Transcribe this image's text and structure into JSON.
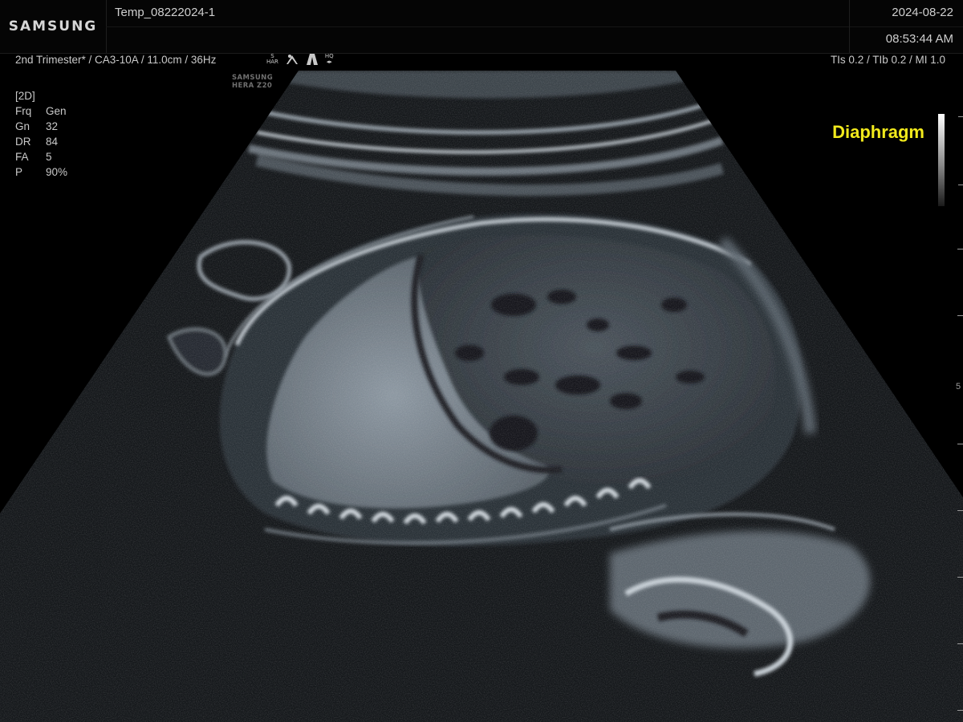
{
  "header": {
    "brand": "SAMSUNG",
    "patient_id": "Temp_08222024-1",
    "date": "2024-08-22",
    "time": "08:53:44 AM"
  },
  "info_line": {
    "text": "2nd Trimester* / CA3-10A / 11.0cm / 36Hz",
    "icon_s_har_top": "S",
    "icon_s_har_bottom": "HAR",
    "icon_hq_top": "HQ",
    "icon_hq_bottom": "◂▸"
  },
  "safety": {
    "text": "TIs  0.2 / TIb  0.2 / MI    1.0"
  },
  "watermark": {
    "line1": "SAMSUNG",
    "line2": "HERA Z20"
  },
  "params": {
    "mode": "[2D]",
    "rows": [
      {
        "key": "Frq",
        "value": "Gen"
      },
      {
        "key": "Gn",
        "value": "32"
      },
      {
        "key": "DR",
        "value": "84"
      },
      {
        "key": "FA",
        "value": "5"
      },
      {
        "key": "P",
        "value": "90%"
      }
    ]
  },
  "annotation": {
    "label": "Diaphragm",
    "color": "#f2ea1c"
  },
  "depth_scale": {
    "label": "5"
  },
  "icons": {
    "s_har": "harmonic-mode-icon",
    "probe": "probe-icon",
    "sector": "sector-icon",
    "hq": "hq-icon"
  }
}
